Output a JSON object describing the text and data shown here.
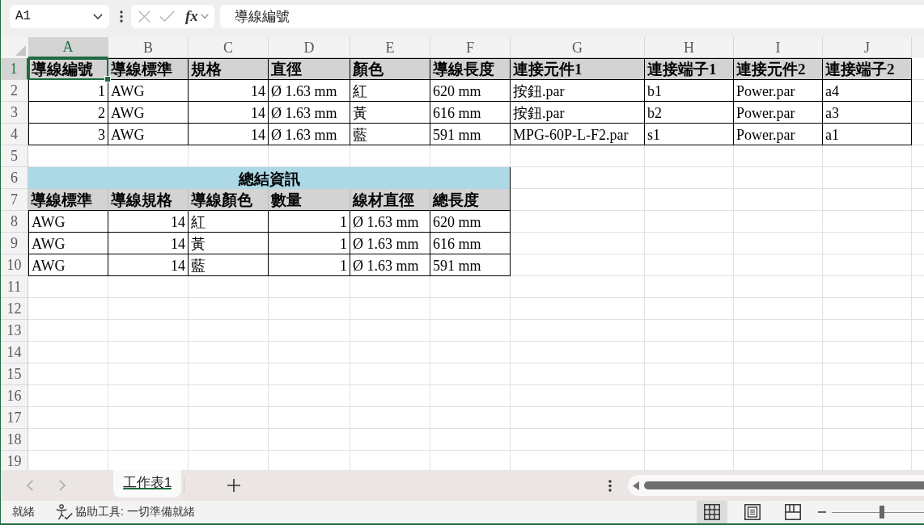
{
  "name_box": {
    "value": "A1"
  },
  "formula_buttons": [
    {
      "kind": "cancel",
      "disabled": true
    },
    {
      "kind": "enter",
      "disabled": true
    }
  ],
  "function_button": {
    "label": "fx"
  },
  "formula_bar": {
    "value": "導線編號"
  },
  "column_headers": [
    {
      "label": "A",
      "selected": true
    },
    {
      "label": "B",
      "selected": false
    },
    {
      "label": "C",
      "selected": false
    },
    {
      "label": "D",
      "selected": false
    },
    {
      "label": "E",
      "selected": false
    },
    {
      "label": "F",
      "selected": false
    },
    {
      "label": "G",
      "selected": false
    },
    {
      "label": "H",
      "selected": false
    },
    {
      "label": "I",
      "selected": false
    },
    {
      "label": "J",
      "selected": false
    }
  ],
  "row_headers": [
    {
      "label": "1",
      "selected": true
    },
    {
      "label": "2",
      "selected": false
    },
    {
      "label": "3",
      "selected": false
    },
    {
      "label": "4",
      "selected": false
    },
    {
      "label": "5",
      "selected": false
    },
    {
      "label": "6",
      "selected": false
    },
    {
      "label": "7",
      "selected": false
    },
    {
      "label": "8",
      "selected": false
    },
    {
      "label": "9",
      "selected": false
    },
    {
      "label": "10",
      "selected": false
    },
    {
      "label": "11",
      "selected": false
    },
    {
      "label": "12",
      "selected": false
    },
    {
      "label": "13",
      "selected": false
    },
    {
      "label": "14",
      "selected": false
    },
    {
      "label": "15",
      "selected": false
    },
    {
      "label": "16",
      "selected": false
    },
    {
      "label": "17",
      "selected": false
    },
    {
      "label": "18",
      "selected": false
    },
    {
      "label": "19",
      "selected": false
    }
  ],
  "wire_table": {
    "columns": [
      {
        "label": "導線編號",
        "kind": "number"
      },
      {
        "label": "導線標準",
        "kind": "text"
      },
      {
        "label": "規格",
        "kind": "number"
      },
      {
        "label": "直徑",
        "kind": "text"
      },
      {
        "label": "顏色",
        "kind": "text"
      },
      {
        "label": "導線長度",
        "kind": "text"
      },
      {
        "label": "連接元件1",
        "kind": "text"
      },
      {
        "label": "連接端子1",
        "kind": "text"
      },
      {
        "label": "連接元件2",
        "kind": "text"
      },
      {
        "label": "連接端子2",
        "kind": "text"
      }
    ],
    "rows": [
      [
        "1",
        "AWG",
        "14",
        "Ø 1.63 mm",
        "紅",
        "620 mm",
        "按鈕.par",
        "b1",
        "Power.par",
        "a4"
      ],
      [
        "2",
        "AWG",
        "14",
        "Ø 1.63 mm",
        "黃",
        "616 mm",
        "按鈕.par",
        "b2",
        "Power.par",
        "a3"
      ],
      [
        "3",
        "AWG",
        "14",
        "Ø 1.63 mm",
        "藍",
        "591 mm",
        "MPG-60P-L-F2.par",
        "s1",
        "Power.par",
        "a1"
      ]
    ]
  },
  "summary_table": {
    "title": "總結資訊",
    "columns": [
      {
        "label": "導線標準",
        "kind": "text"
      },
      {
        "label": "導線規格",
        "kind": "number"
      },
      {
        "label": "導線顏色",
        "kind": "text"
      },
      {
        "label": "數量",
        "kind": "number"
      },
      {
        "label": "線材直徑",
        "kind": "text"
      },
      {
        "label": "總長度",
        "kind": "text"
      }
    ],
    "rows": [
      [
        "AWG",
        "14",
        "紅",
        "1",
        "Ø 1.63 mm",
        "620 mm"
      ],
      [
        "AWG",
        "14",
        "黃",
        "1",
        "Ø 1.63 mm",
        "616 mm"
      ],
      [
        "AWG",
        "14",
        "藍",
        "1",
        "Ø 1.63 mm",
        "591 mm"
      ]
    ]
  },
  "sheet_nav": [
    {
      "kind": "previous",
      "disabled": true
    },
    {
      "kind": "next",
      "disabled": true
    }
  ],
  "sheet_tabs": [
    {
      "label": "工作表1",
      "selected": true
    }
  ],
  "status_bar": {
    "mode": "就緒",
    "accessibility": "協助工具: 一切準備就緒",
    "views": [
      {
        "kind": "normal",
        "selected": true
      },
      {
        "kind": "page_layout",
        "selected": false
      },
      {
        "kind": "page_break",
        "selected": false
      }
    ],
    "zoom": {
      "level": 0.54
    }
  }
}
